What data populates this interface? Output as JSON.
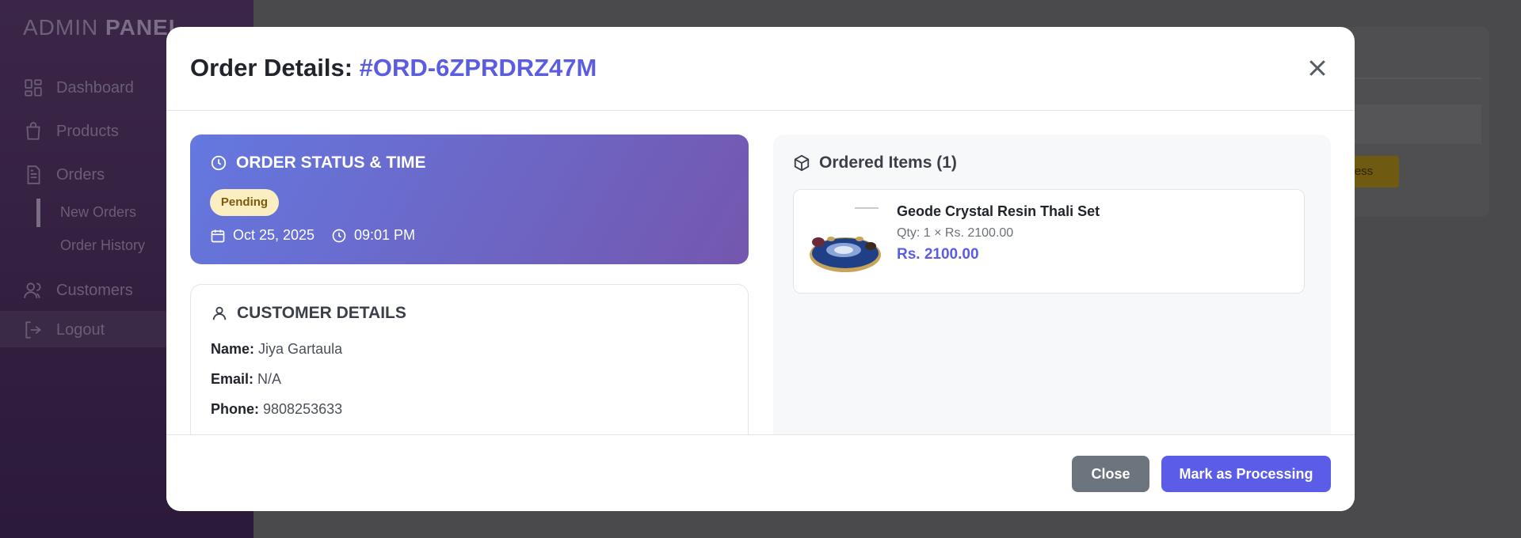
{
  "sidebar": {
    "brand_light": "ADMIN",
    "brand_bold": "PANEL",
    "items": [
      {
        "label": "Dashboard",
        "icon": "grid-icon"
      },
      {
        "label": "Products",
        "icon": "bag-icon"
      },
      {
        "label": "Orders",
        "icon": "document-icon"
      },
      {
        "label": "Customers",
        "icon": "users-icon"
      },
      {
        "label": "Logout",
        "icon": "logout-icon"
      }
    ],
    "sub_items": [
      {
        "label": "New Orders"
      },
      {
        "label": "Order History"
      }
    ]
  },
  "background": {
    "button_fragment": "ocess"
  },
  "modal": {
    "title_prefix": "Order Details:",
    "order_id": "#ORD-6ZPRDRZ47M",
    "status_section": {
      "heading": "ORDER STATUS & TIME",
      "status": "Pending",
      "date": "Oct 25, 2025",
      "time": "09:01 PM"
    },
    "customer_section": {
      "heading": "CUSTOMER DETAILS",
      "name_label": "Name:",
      "name": "Jiya Gartaula",
      "email_label": "Email:",
      "email": "N/A",
      "phone_label": "Phone:",
      "phone": "9808253633"
    },
    "items_section": {
      "heading": "Ordered Items (1)",
      "items": [
        {
          "name": "Geode Crystal Resin Thali Set",
          "qty_line": "Qty: 1 × Rs. 2100.00",
          "total": "Rs. 2100.00"
        }
      ]
    },
    "footer": {
      "close_label": "Close",
      "primary_label": "Mark as Processing"
    }
  },
  "colors": {
    "accent": "#5b5ce0",
    "status_gradient_start": "#6478e0",
    "status_gradient_end": "#7457ae",
    "pending_badge_bg": "#fbeec1",
    "close_button": "#6c757d"
  }
}
